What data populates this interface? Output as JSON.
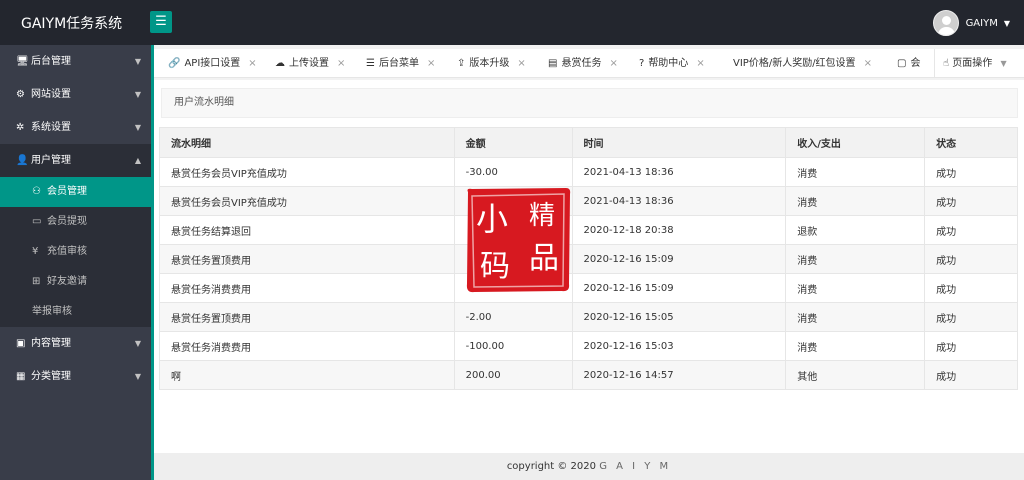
{
  "app": {
    "title": "GAIYM任务系统",
    "menu_icon": "hamburger-icon"
  },
  "user": {
    "name": "GAIYM",
    "avatar_icon": "user-avatar-icon"
  },
  "sidebar": {
    "items": [
      {
        "label": "后台管理",
        "icon": "monitor-icon"
      },
      {
        "label": "网站设置",
        "icon": "web-settings-icon"
      },
      {
        "label": "系统设置",
        "icon": "gear-icon"
      },
      {
        "label": "用户管理",
        "icon": "users-icon"
      },
      {
        "label": "内容管理",
        "icon": "book-icon"
      },
      {
        "label": "分类管理",
        "icon": "grid-icon"
      }
    ],
    "sub_items": [
      {
        "label": "会员管理",
        "icon": "user-icon"
      },
      {
        "label": "会员提现",
        "icon": "withdraw-icon"
      },
      {
        "label": "充值审核",
        "icon": "yen-icon"
      },
      {
        "label": "好友邀请",
        "icon": "gift-icon"
      },
      {
        "label": "举报审核",
        "icon": ""
      }
    ]
  },
  "tabs": [
    {
      "label": "API接口设置",
      "icon": "link-icon"
    },
    {
      "label": "上传设置",
      "icon": "cloud-upload-icon"
    },
    {
      "label": "后台菜单",
      "icon": "list-icon"
    },
    {
      "label": "版本升级",
      "icon": "upgrade-icon"
    },
    {
      "label": "悬赏任务",
      "icon": "document-icon"
    },
    {
      "label": "帮助中心",
      "icon": "help-icon"
    },
    {
      "label": "VIP价格/新人奖励/红包设置",
      "icon": ""
    },
    {
      "label": "会",
      "icon": "user-card-icon"
    }
  ],
  "page_ops": {
    "label": "页面操作"
  },
  "breadcrumb": "用户流水明细",
  "table": {
    "headers": [
      "流水明细",
      "金额",
      "时间",
      "收入/支出",
      "状态"
    ],
    "rows": [
      [
        "悬赏任务会员VIP充值成功",
        "-30.00",
        "2021-04-13 18:36",
        "消费",
        "成功"
      ],
      [
        "悬赏任务会员VIP充值成功",
        "",
        "2021-04-13 18:36",
        "消费",
        "成功"
      ],
      [
        "悬赏任务结算退回",
        "",
        "2020-12-18 20:38",
        "退款",
        "成功"
      ],
      [
        "悬赏任务置顶费用",
        "",
        "2020-12-16 15:09",
        "消费",
        "成功"
      ],
      [
        "悬赏任务消费费用",
        "",
        "2020-12-16 15:09",
        "消费",
        "成功"
      ],
      [
        "悬赏任务置顶费用",
        "-2.00",
        "2020-12-16 15:05",
        "消费",
        "成功"
      ],
      [
        "悬赏任务消费费用",
        "-100.00",
        "2020-12-16 15:03",
        "消费",
        "成功"
      ],
      [
        "啊",
        "200.00",
        "2020-12-16 14:57",
        "其他",
        "成功"
      ]
    ]
  },
  "watermark": {
    "chars": [
      "小",
      "精",
      "码",
      "品"
    ],
    "color": "#d71920"
  },
  "footer": {
    "prefix": "copyright © 2020",
    "brand": "G A I Y M"
  },
  "colors": {
    "accent": "#009688",
    "header_bg": "#23262e",
    "sidebar_bg": "#393d49"
  }
}
